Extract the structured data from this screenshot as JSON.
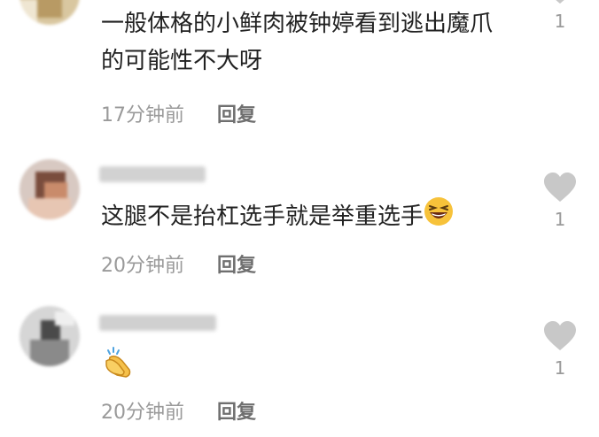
{
  "comments": [
    {
      "username": "",
      "text": "一般体格的小鲜肉被钟婷看到逃出魔爪的可能性不大呀",
      "time": "17分钟前",
      "reply_label": "回复",
      "like_count": "1"
    },
    {
      "username": "",
      "text": "这腿不是抬杠选手就是举重选手",
      "emoji": "grinning-squinting-face-emoji",
      "time": "20分钟前",
      "reply_label": "回复",
      "like_count": "1"
    },
    {
      "username": "",
      "text": "",
      "emoji": "clapping-hands-emoji",
      "time": "20分钟前",
      "reply_label": "回复",
      "like_count": "1"
    }
  ],
  "colors": {
    "text": "#222222",
    "meta": "#9a9a9a",
    "heart": "#c8c8c8"
  },
  "icons": {
    "like": "heart-icon"
  }
}
